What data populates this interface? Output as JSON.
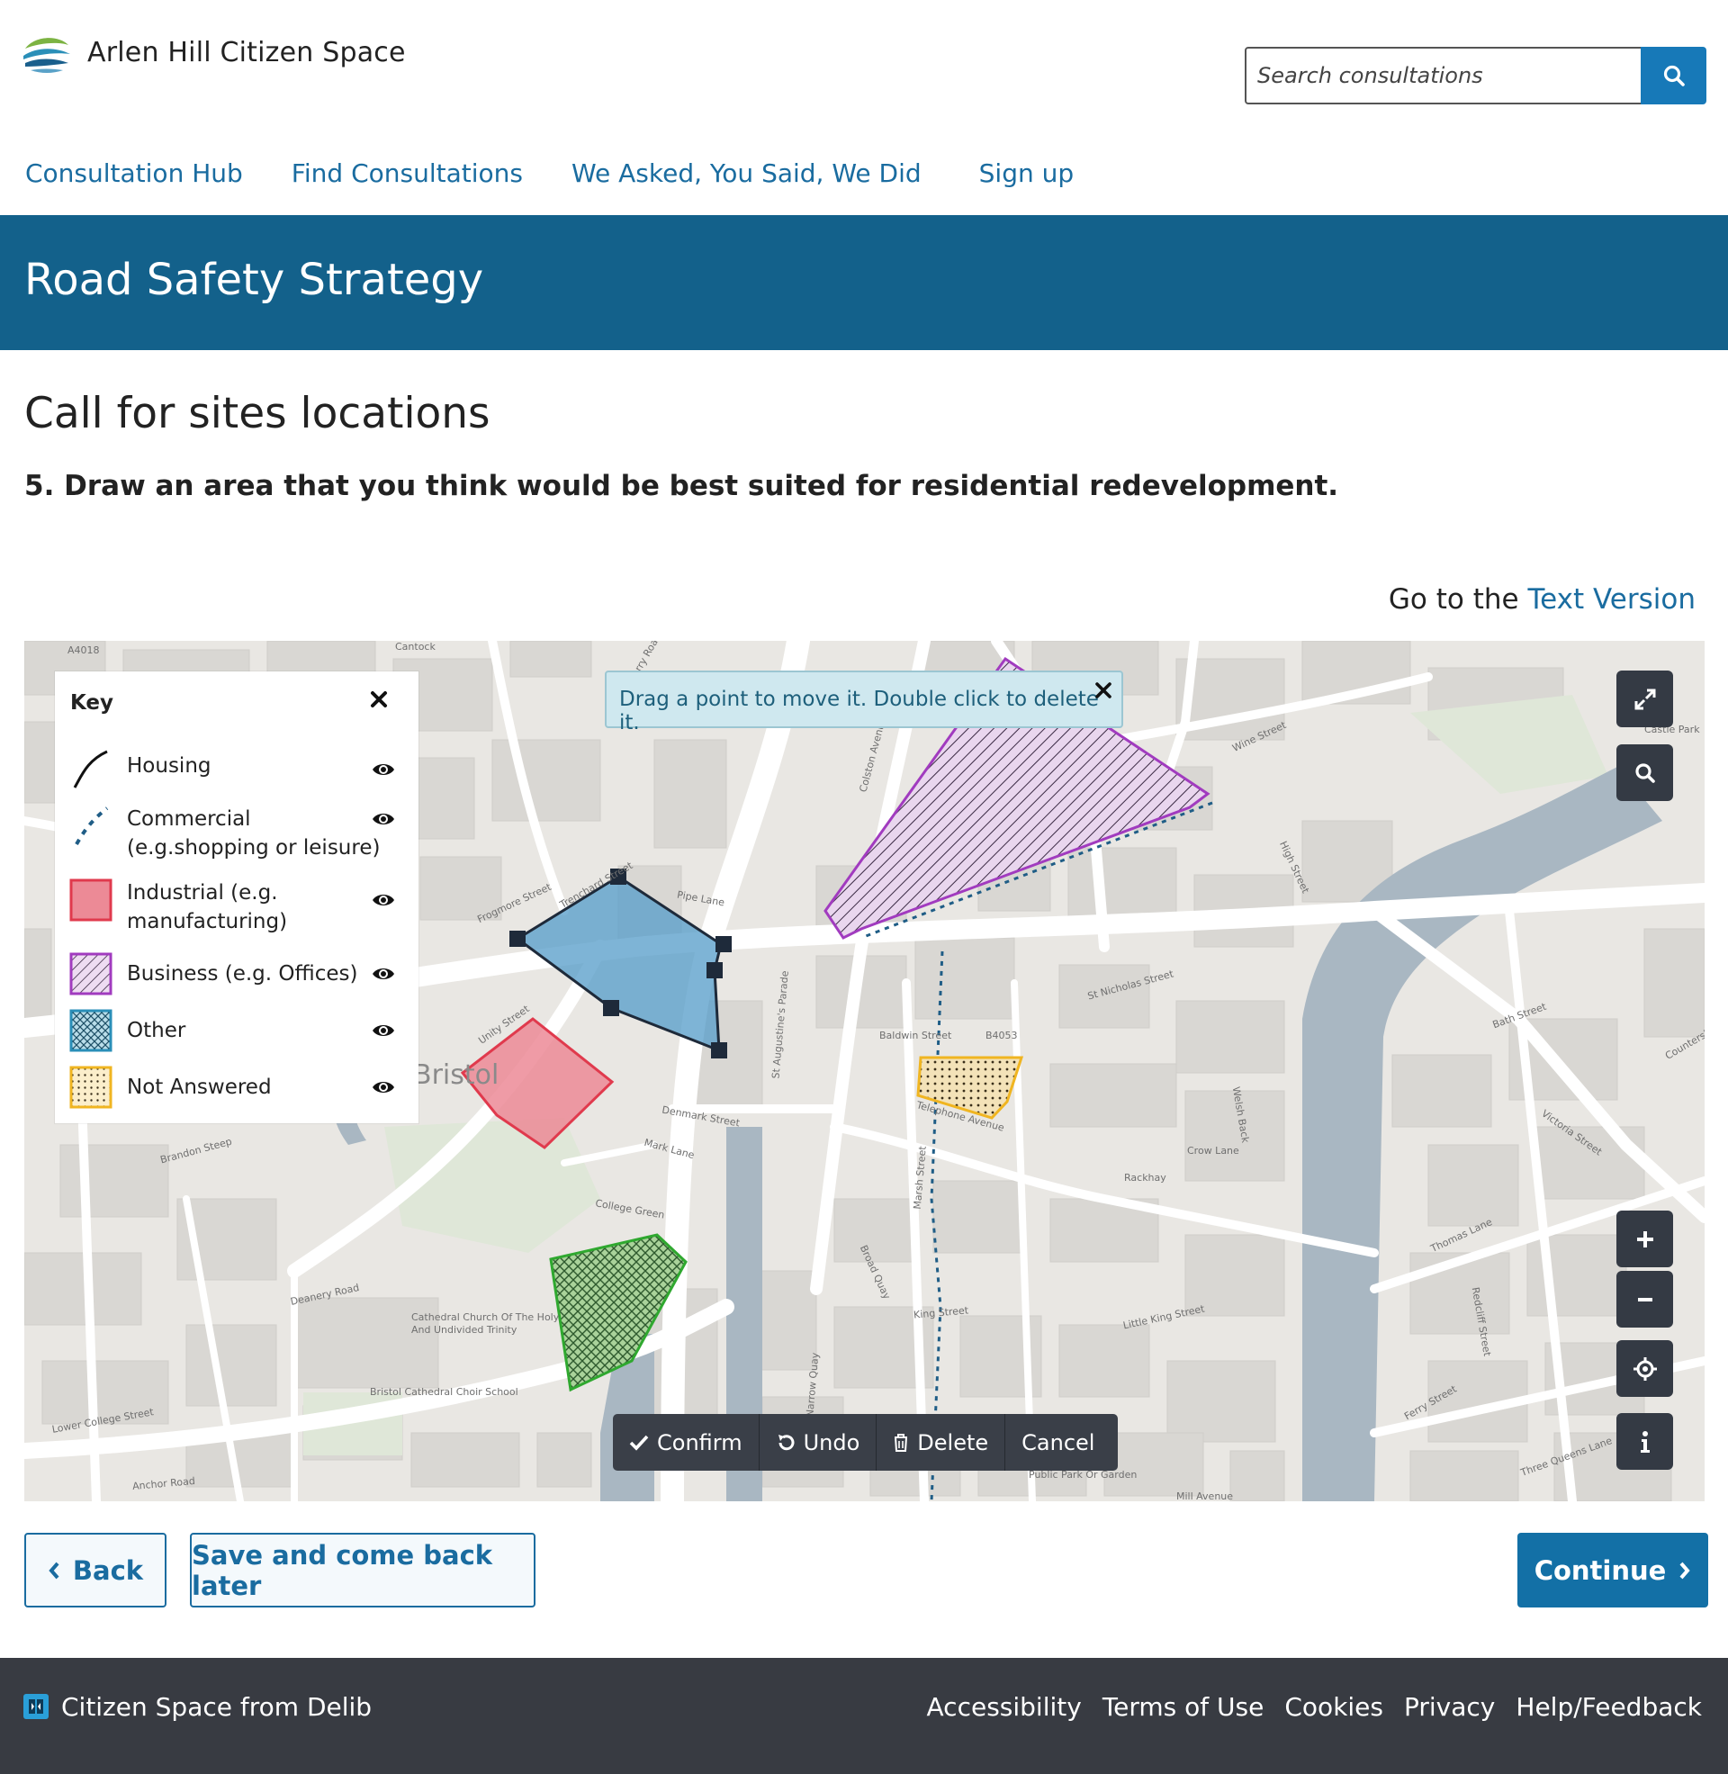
{
  "site": {
    "name": "Arlen Hill Citizen Space",
    "logo_icon": "wave-logo-icon"
  },
  "search": {
    "placeholder": "Search consultations",
    "button_icon": "search-icon"
  },
  "nav": {
    "items": [
      "Consultation Hub",
      "Find Consultations",
      "We Asked, You Said, We Did",
      "Sign up"
    ]
  },
  "banner": {
    "title": "Road Safety Strategy"
  },
  "page": {
    "section_title": "Call for sites locations",
    "question": "5. Draw an area that you think would be best suited for residential redevelopment.",
    "text_version_prefix": "Go to the",
    "text_version_link": "Text Version"
  },
  "map": {
    "key": {
      "title": "Key",
      "items": [
        {
          "label": "Housing",
          "style": "solid-line"
        },
        {
          "label": "Commercial\n(e.g.shopping or leisure)",
          "style": "dashed-line"
        },
        {
          "label": "Industrial (e.g.\nmanufacturing)",
          "style": "red-fill",
          "color": "#e03a4d"
        },
        {
          "label": "Business (e.g. Offices)",
          "style": "diagonal-hatch",
          "color": "#a13bbf"
        },
        {
          "label": "Other",
          "style": "cross-hatch",
          "color": "#2a8fb8"
        },
        {
          "label": "Not Answered",
          "style": "dots",
          "color": "#f0b521"
        }
      ]
    },
    "tooltip": "Drag a point to move it. Double click to delete it.",
    "labels": [
      "A4018",
      "Cantock",
      "Perry Road",
      "Frogmore Street",
      "Trenchard Street",
      "Pipe Lane",
      "Colston Avenue",
      "St Augustine's Parade",
      "Baldwin Street",
      "B4053",
      "St Nicholas Street",
      "High Street",
      "Wine Street",
      "Welsh Back",
      "Victoria Street",
      "Denmark Street",
      "Mark Lane",
      "College Green",
      "Deanery Road",
      "Cathedral Church Of The Holy And Undivided Trinity",
      "Bristol Cathedral Choir School",
      "Anchor Road",
      "Lower College Street",
      "Marsh Street",
      "King Street",
      "Narrow Quay",
      "Broad Quay",
      "Little King Street",
      "Thomas Lane",
      "Redcliff Street",
      "Three Queens Lane",
      "Bath Street",
      "Telephone Avenue",
      "Crow Lane",
      "Rackhay",
      "Public Park Or Garden",
      "Mill Avenue",
      "Castle Park",
      "Brandon Steep",
      "Bristol",
      "Unity Street",
      "Ferry Street",
      "Counterslip"
    ],
    "colors": {
      "housing": "#1e2a3a",
      "industrial": "#e03a4d",
      "business": "#a13bbf",
      "other": "#2a7fb8",
      "not_answered": "#f0b521",
      "green": "#2fa82f"
    },
    "controls": [
      "fullscreen-icon",
      "search-icon",
      "zoom-in-icon",
      "zoom-out-icon",
      "locate-icon",
      "info-icon"
    ],
    "toolbar": {
      "confirm": "Confirm",
      "undo": "Undo",
      "delete": "Delete",
      "cancel": "Cancel"
    }
  },
  "buttons": {
    "back": "Back",
    "save": "Save and come back later",
    "continue": "Continue"
  },
  "footer": {
    "brand": "Citizen Space from Delib",
    "links": [
      "Accessibility",
      "Terms of Use",
      "Cookies",
      "Privacy",
      "Help/Feedback"
    ]
  }
}
